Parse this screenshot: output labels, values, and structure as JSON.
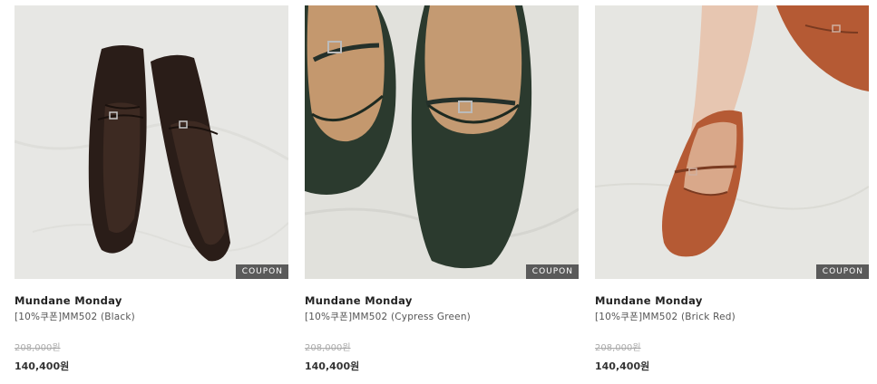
{
  "products": [
    {
      "brand": "Mundane Monday",
      "name": "[10%쿠폰]MM502 (Black)",
      "badge": "COUPON",
      "original_price": "208,000원",
      "sale_price": "140,400원",
      "image": "black-mary-jane-flats-photo"
    },
    {
      "brand": "Mundane Monday",
      "name": "[10%쿠폰]MM502 (Cypress Green)",
      "badge": "COUPON",
      "original_price": "208,000원",
      "sale_price": "140,400원",
      "image": "cypress-green-mary-jane-flats-photo"
    },
    {
      "brand": "Mundane Monday",
      "name": "[10%쿠폰]MM502 (Brick Red)",
      "badge": "COUPON",
      "original_price": "208,000원",
      "sale_price": "140,400원",
      "image": "brick-red-mary-jane-flats-photo"
    }
  ],
  "colors": {
    "badge_bg": "#5a5a5a",
    "black_shoe": "#2a1d18",
    "green_shoe": "#2b3a2e",
    "red_shoe": "#b55a34"
  }
}
